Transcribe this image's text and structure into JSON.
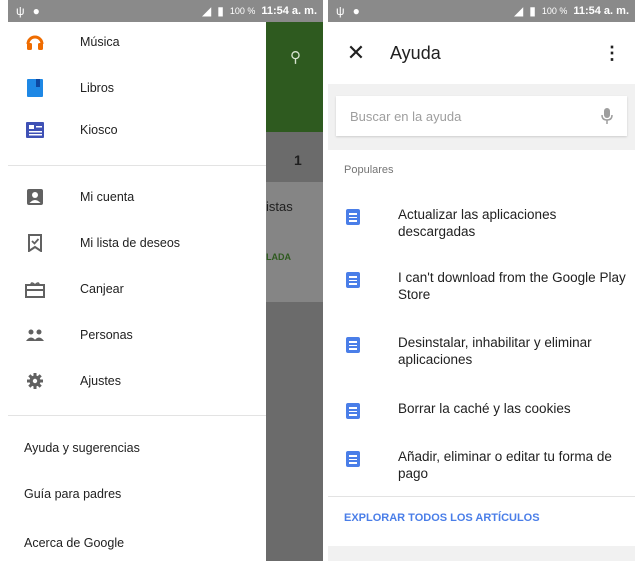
{
  "left_status": {
    "time": "11:54 a. m.",
    "battery": "100 %"
  },
  "right_status": {
    "time": "11:54 a. m.",
    "battery": "100 %"
  },
  "background_app": {
    "number": "1",
    "listas_fragment": "istas",
    "installed_fragment": "LADA"
  },
  "drawer": {
    "apps": [
      {
        "label": "Música",
        "icon": "headphones-icon",
        "color": "#ef6c00"
      },
      {
        "label": "Libros",
        "icon": "book-icon",
        "color": "#1e88e5"
      },
      {
        "label": "Kiosco",
        "icon": "newsstand-icon",
        "color": "#3f51b5"
      }
    ],
    "account": [
      {
        "label": "Mi cuenta",
        "icon": "account-icon"
      },
      {
        "label": "Mi lista de deseos",
        "icon": "wishlist-icon"
      },
      {
        "label": "Canjear",
        "icon": "redeem-icon"
      },
      {
        "label": "Personas",
        "icon": "people-icon"
      },
      {
        "label": "Ajustes",
        "icon": "settings-icon"
      }
    ],
    "footer": [
      {
        "label": "Ayuda y sugerencias"
      },
      {
        "label": "Guía para padres"
      },
      {
        "label": "Acerca de Google"
      }
    ]
  },
  "help": {
    "title": "Ayuda",
    "search_placeholder": "Buscar en la ayuda",
    "section_title": "Populares",
    "articles": [
      {
        "label": "Actualizar las aplicaciones descargadas"
      },
      {
        "label": "I can't download from the Google Play Store"
      },
      {
        "label": "Desinstalar, inhabilitar y eliminar aplicaciones"
      },
      {
        "label": "Borrar la caché y las cookies"
      },
      {
        "label": "Añadir, eliminar o editar tu forma de pago"
      }
    ],
    "explore_label": "EXPLORAR TODOS LOS ARTÍCULOS"
  },
  "colors": {
    "accent_blue": "#4a7ee8",
    "play_green": "#2e5a1f",
    "status_gray": "#8a8a8a"
  }
}
